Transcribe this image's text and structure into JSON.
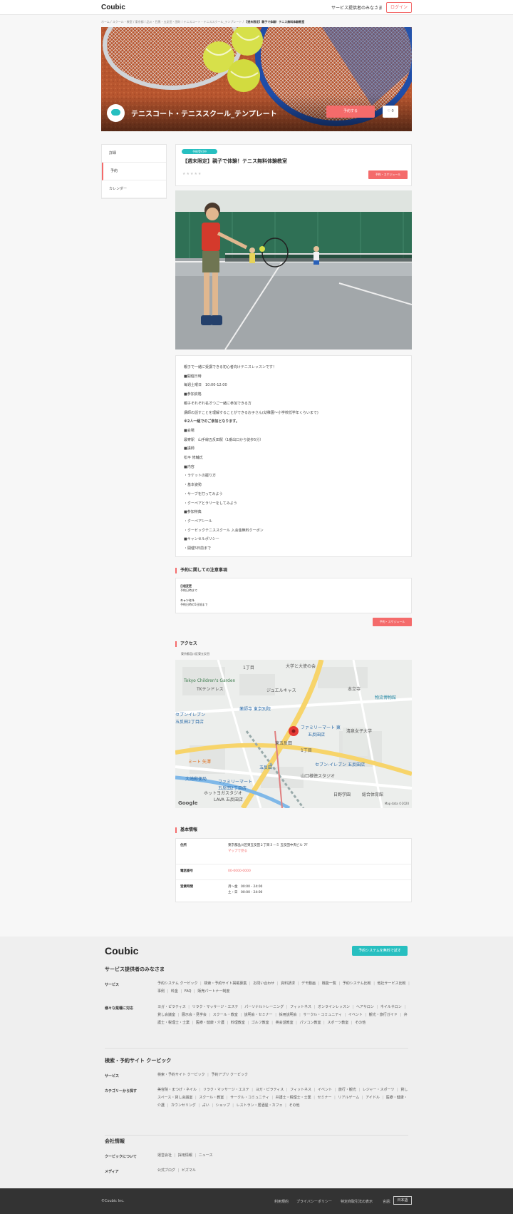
{
  "header": {
    "logo": "Coubic",
    "provider_link": "サービス提供者のみなさま",
    "login": "ログイン"
  },
  "breadcrumb": {
    "path": "ホーム / スクール・教室 / 東京都 / 品川・目黒・五反田・田町 / テニスコート・テニススクール_テンプレート / ",
    "current": "【週末限定】親子で体験！テニス無料体験教室"
  },
  "hero": {
    "shop_name": "テニスコート・テニススクール_テンプレート",
    "book_button": "予約する",
    "fav_count": "0"
  },
  "sidebar": {
    "items": [
      {
        "label": "詳細"
      },
      {
        "label": "予約"
      },
      {
        "label": "カレンダー"
      }
    ]
  },
  "menu": {
    "badge": "予約受付中",
    "title": "【週末限定】親子で体験！テニス無料体験教室",
    "stars": "★★★★★",
    "schedule_button": "予約・スケジュール"
  },
  "description": {
    "lines": [
      "親子で一緒に受講できる初心者向けテニスレッスンです！",
      "■開催日時",
      "毎週土曜日　10:00-12:00",
      "■参加資格",
      "親子それぞれ名才つ",
      "ご一緒に参加できる方",
      "講師の話すことを理解することができるお子さん(幼稚園〜小学校低学年くらいまで)",
      "※2人一組でのご参加となります。",
      "■会場",
      "最寄駅　山手線五反田駅（1番出口から徒歩5分）",
      "■講師",
      "松平 修輔氏",
      "■内容",
      "・ラケットの握り方",
      "・基本姿勢",
      "・サーブを打ってみよう",
      "・クーペアとラリーをしてみよう",
      "■参加特典",
      "・クーペアシール",
      "・クービックテニススクール 入会金無料クーポン",
      "■キャンセルポリシー",
      "・開催5日前まで"
    ]
  },
  "notice": {
    "title": "予約に関しての注意事項",
    "items": [
      {
        "k": "日程変更",
        "v": "予約日時まで"
      },
      {
        "k": "キャンセル",
        "v": "予約日時の5日前まで"
      }
    ],
    "schedule_button": "予約・スケジュール"
  },
  "access": {
    "title": "アクセス",
    "address": "東京都品川区東五反田",
    "map_labels": [
      "1丁目",
      "大学と大使の会",
      "Tokyo Children's Garden",
      "TKテンドレス",
      "ジュエルキャス",
      "本立寺",
      "物流博物館",
      "セブンイレブン",
      "五反田2丁目店",
      "薬師寺 東京別院",
      "ファミリーマート 東",
      "五反田店",
      "清泉女子大学",
      "ミート 矢澤",
      "東五反田",
      "五反田",
      "セブン-イレブン 五反田店",
      "山口様徳スタジオ",
      "大崎郵便局",
      "ファミリーマート",
      "五反田2丁目店",
      "ホットヨガスタジオ",
      "LAVA 五反田店",
      "日野学園",
      "総合体育館",
      "1丁目"
    ],
    "google": "Google",
    "map_data": "Map data ©2020"
  },
  "basic": {
    "title": "基本情報",
    "rows": [
      {
        "k": "住所",
        "v": "東京都品川区東五反田２丁目３－５ 五反田中央ビル 7F",
        "link": "マップで見る"
      },
      {
        "k": "電話番号",
        "v": "00-0000-0000"
      },
      {
        "k": "営業時間",
        "v": "月〜金　00:00 - 24:00",
        "v2": "土・日　00:00 - 24:00"
      }
    ]
  },
  "footer": {
    "logo": "Coubic",
    "cta": "予約システムを無料で試す",
    "provider_title": "サービス提供者のみなさま",
    "service_label": "サービス",
    "service_links": [
      "予約システム クービック",
      "検索・予約サイト掲載募集",
      "お問い合わせ",
      "資料請求",
      "デモ動画",
      "機能一覧",
      "予約システム比較",
      "他社サービス比較",
      "事例",
      "料金",
      "FAQ",
      "販売パートナー制度"
    ],
    "industry_label": "様々な業種に対応",
    "industry_links": [
      "ヨガ・ピラティス",
      "リラク・マッサージ・エステ",
      "パーソナルトレーニング",
      "フィットネス",
      "オンラインレッスン",
      "ヘアサロン",
      "ネイルサロン",
      "貸し会議室",
      "展示会・見学会",
      "スクール・教室",
      "説明会・セミナー",
      "採用説明会",
      "サークル・コミュニティ",
      "イベント",
      "観光・旅行ガイド",
      "弁護士・税理士・士業",
      "医療・健康・介護",
      "料理教室",
      "ゴルフ教室",
      "英会話教室",
      "パソコン教室",
      "スポーツ教室",
      "その他"
    ],
    "search_title": "検索・予約サイト クービック",
    "search_service_label": "サービス",
    "search_service_links": [
      "検索・予約サイト クービック",
      "予約アプリ クービック"
    ],
    "category_label": "カテゴリーから探す",
    "category_links": [
      "美容院・まつげ・ネイル",
      "リラク・マッサージ・エステ",
      "ヨガ・ピラティス",
      "フィットネス",
      "イベント",
      "旅行・観光",
      "レジャー・スポーツ",
      "貸しスペース・貸し会議室",
      "スクール・教室",
      "サークル・コミュニティ",
      "弁護士・税理士・士業",
      "セミナー",
      "リアルゲーム",
      "アイドル",
      "医療・健康・介護",
      "カウンセリング",
      "占い",
      "ショップ",
      "レストラン・居酒屋・カフェ",
      "その他"
    ],
    "company_title": "会社情報",
    "about_label": "クービックについて",
    "about_links": [
      "運営会社",
      "採用情報",
      "ニュース"
    ],
    "media_label": "メディア",
    "media_links": [
      "公式ブログ",
      "ビズマル"
    ]
  },
  "bottom": {
    "copyright": "©Coubic Inc.",
    "links": [
      "利用規約",
      "プライバシーポリシー",
      "特定商取引法の表示"
    ],
    "lang_label": "言語:",
    "lang": "日本語"
  }
}
